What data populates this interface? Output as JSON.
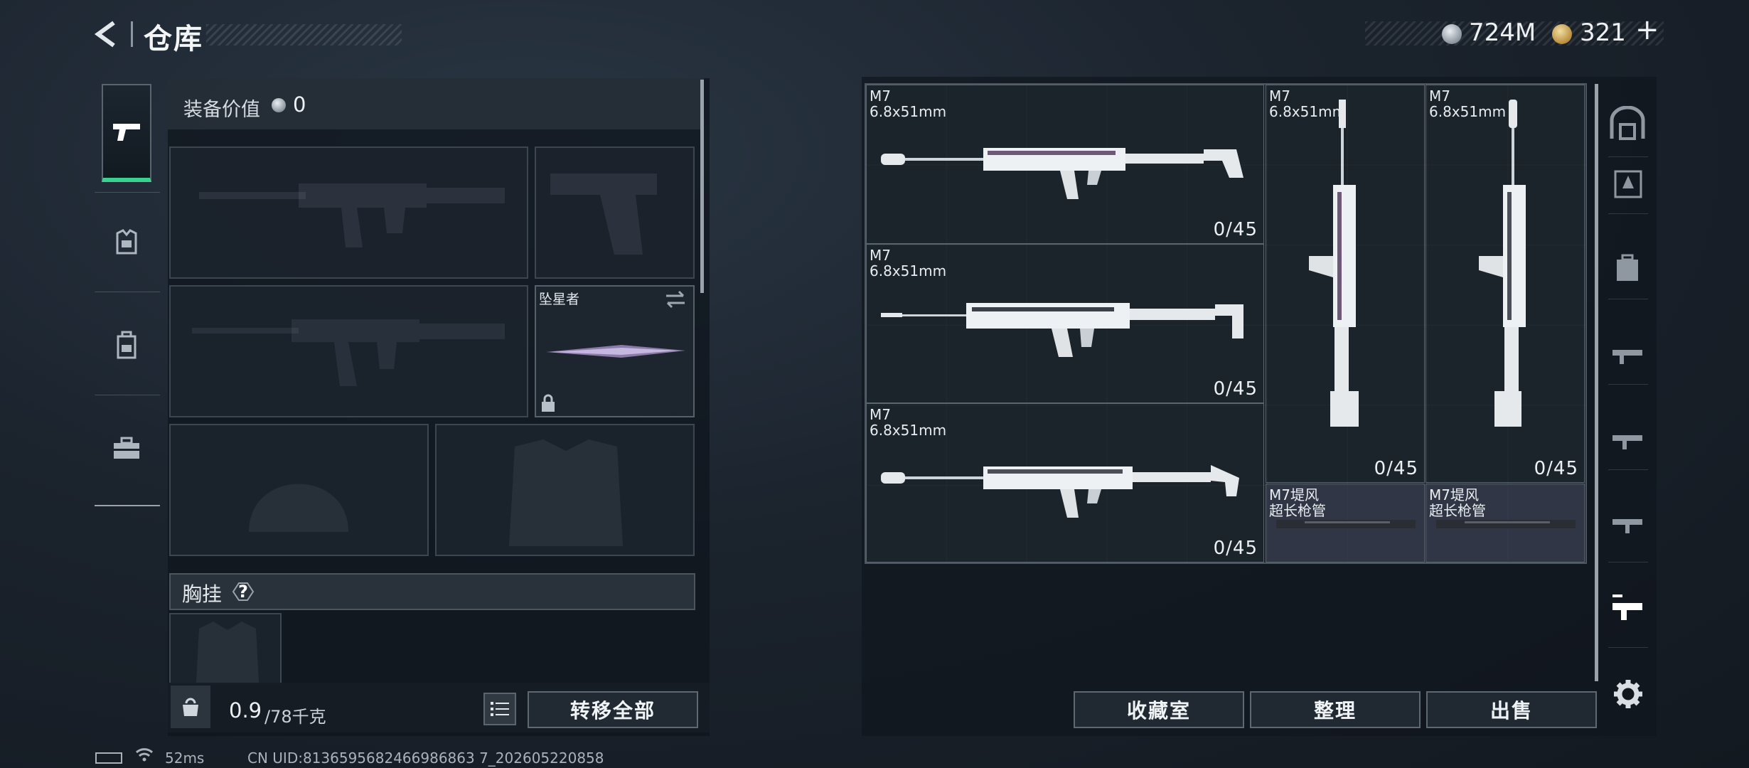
{
  "header": {
    "back_icon": "chevron-left-icon",
    "title": "仓库",
    "currency_silver": "724M",
    "currency_gold": "321",
    "add_label": "+"
  },
  "sidebar": {
    "items": [
      {
        "id": "weapons",
        "icon": "pistol-icon",
        "active": true
      },
      {
        "id": "armor",
        "icon": "vest-icon",
        "active": false
      },
      {
        "id": "backpack",
        "icon": "backpack-icon",
        "active": false
      },
      {
        "id": "toolbox",
        "icon": "toolbox-icon",
        "active": false
      }
    ]
  },
  "loadout": {
    "equip_value_label": "装备价值",
    "equip_value": "0",
    "melee_name": "坠星者",
    "chest_rig_label": "胸挂",
    "chest_help": "?",
    "weight_current": "0.9",
    "weight_max": "/78千克",
    "transfer_all_label": "转移全部"
  },
  "stash": {
    "items": [
      {
        "name": "M7",
        "caliber": "6.8x51mm",
        "count": "0/45"
      },
      {
        "name": "M7",
        "caliber": "6.8x51mm",
        "count": "0/45"
      },
      {
        "name": "M7",
        "caliber": "6.8x51mm",
        "count": "0/45"
      },
      {
        "name": "M7",
        "caliber": "6.8x51mm",
        "count": "0/45"
      },
      {
        "name": "M7",
        "caliber": "6.8x51mm",
        "count": "0/45"
      },
      {
        "name": "M7堤风",
        "caliber": "超长枪管",
        "count": ""
      },
      {
        "name": "M7堤风",
        "caliber": "超长枪管",
        "count": ""
      }
    ],
    "collection_label": "收藏室",
    "sort_label": "整理",
    "sell_label": "出售"
  },
  "footer": {
    "ping": "52ms",
    "uid": "CN UID:8136595682466986863 7_202605220858"
  },
  "colors": {
    "accent_green": "#39d38f",
    "panel_bg": "#10161d",
    "border": "#5d6872"
  }
}
